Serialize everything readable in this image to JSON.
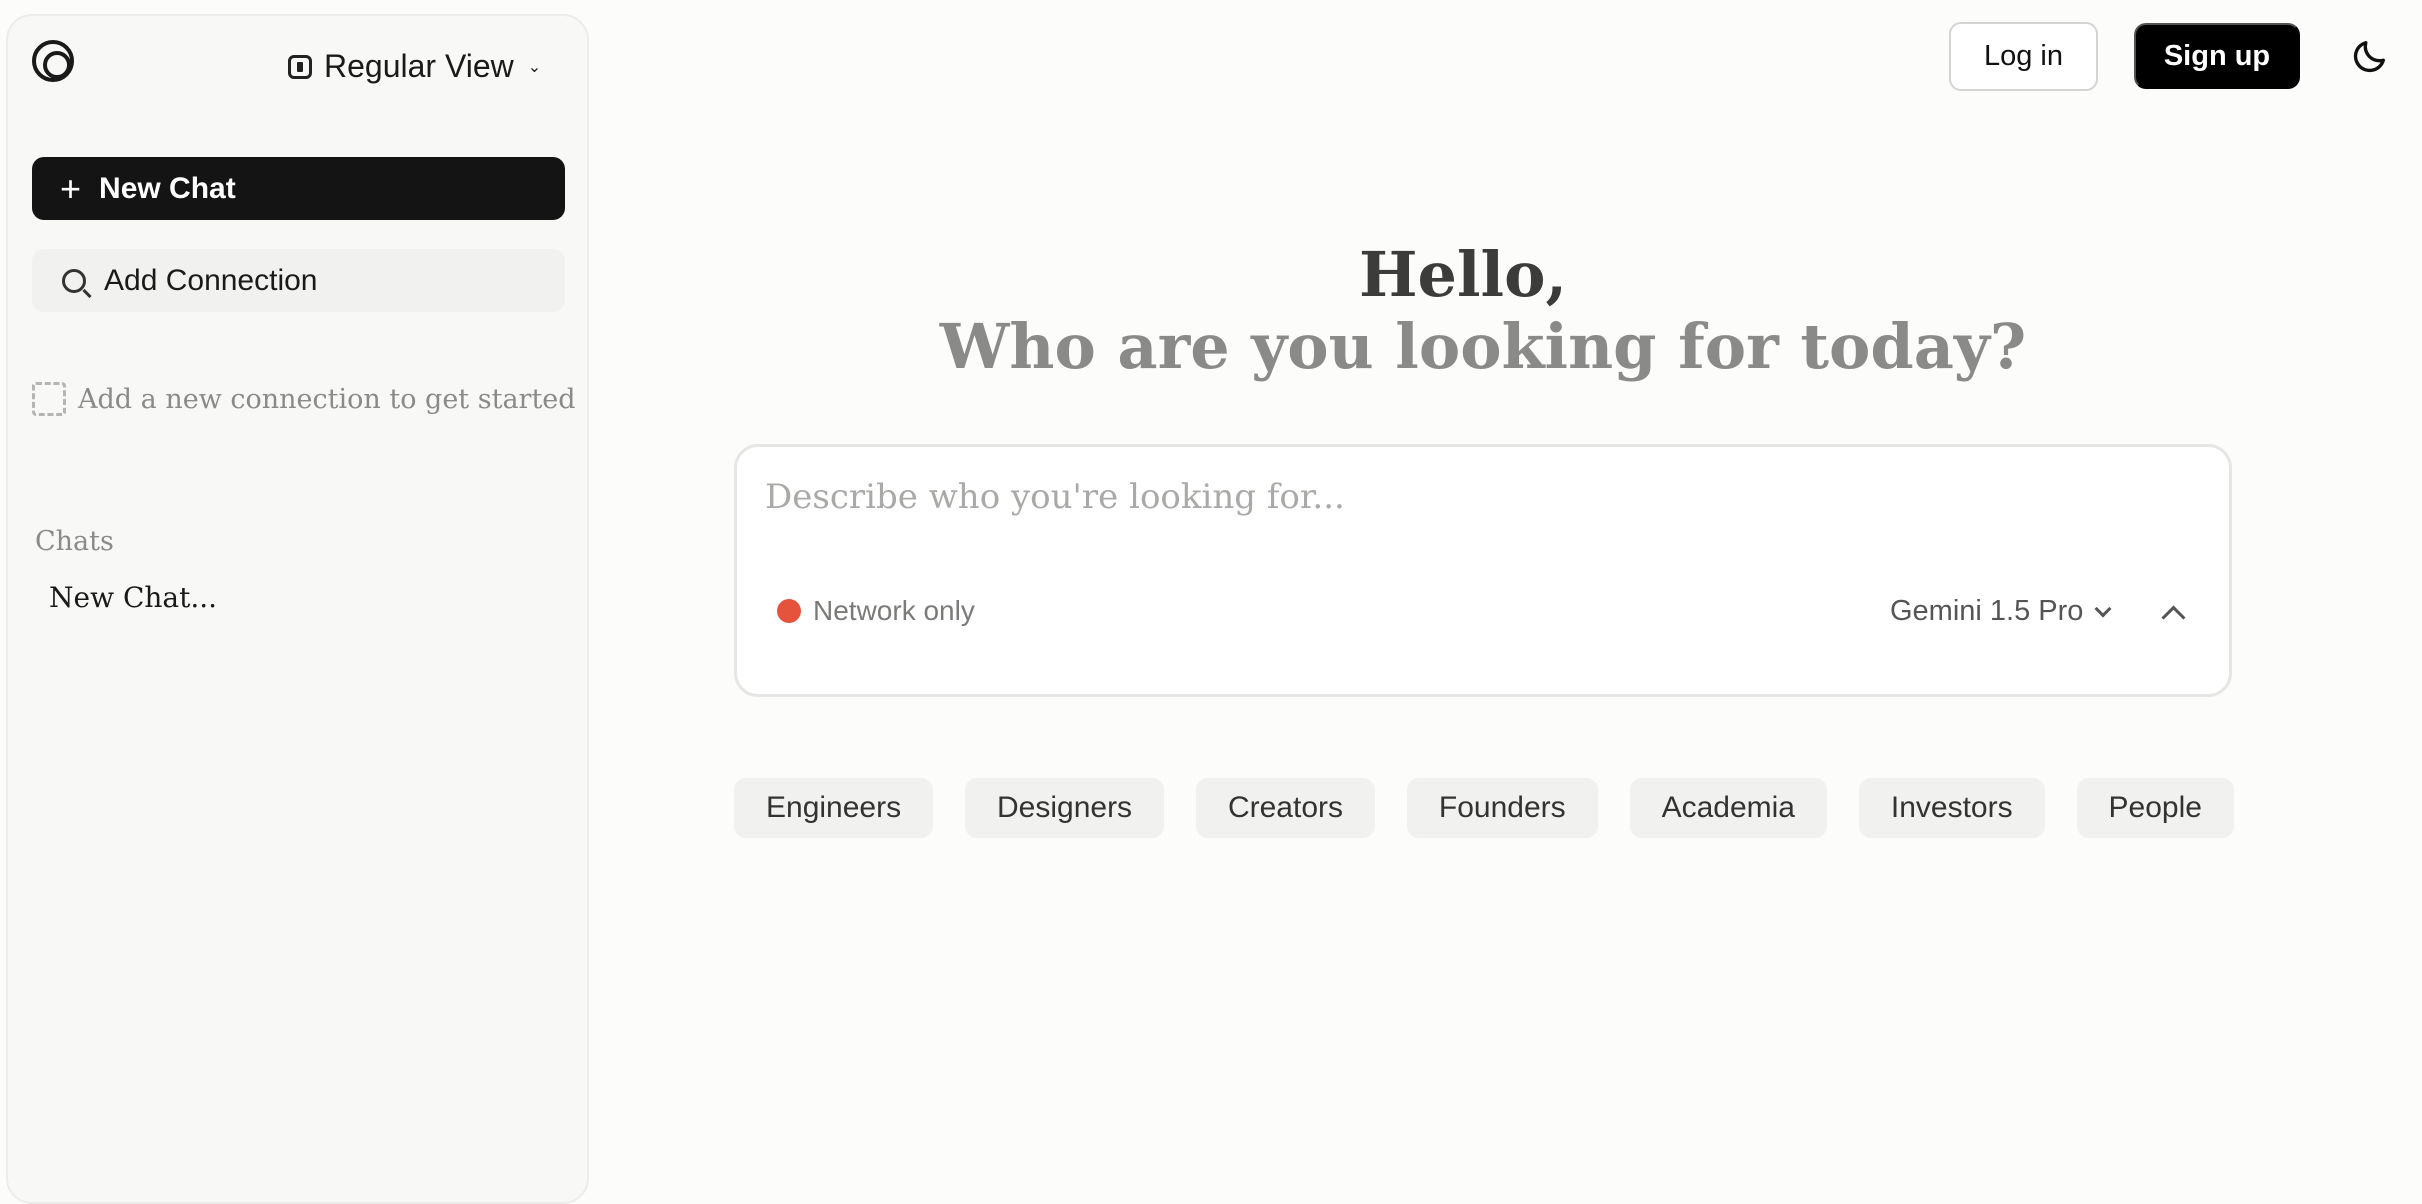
{
  "sidebar": {
    "view_label": "Regular View",
    "new_chat_label": "New Chat",
    "add_connection_label": "Add Connection",
    "empty_hint": "Add a new connection to get started",
    "chats_heading": "Chats",
    "chats": [
      "New Chat..."
    ]
  },
  "header": {
    "login_label": "Log in",
    "signup_label": "Sign up"
  },
  "main": {
    "greeting": "Hello,",
    "subtitle": "Who are you looking for today?",
    "composer": {
      "placeholder": "Describe who you're looking for...",
      "scope_label": "Network only",
      "scope_color": "#e5533d",
      "model_label": "Gemini 1.5 Pro"
    },
    "chips": [
      "Engineers",
      "Designers",
      "Creators",
      "Founders",
      "Academia",
      "Investors",
      "People"
    ]
  },
  "icons": {
    "logo": "logo-icon",
    "view": "view-mode-icon",
    "new_chat": "plus-icon",
    "add_connection": "search-icon",
    "theme": "moon-icon",
    "collapse": "chevron-up-icon"
  }
}
